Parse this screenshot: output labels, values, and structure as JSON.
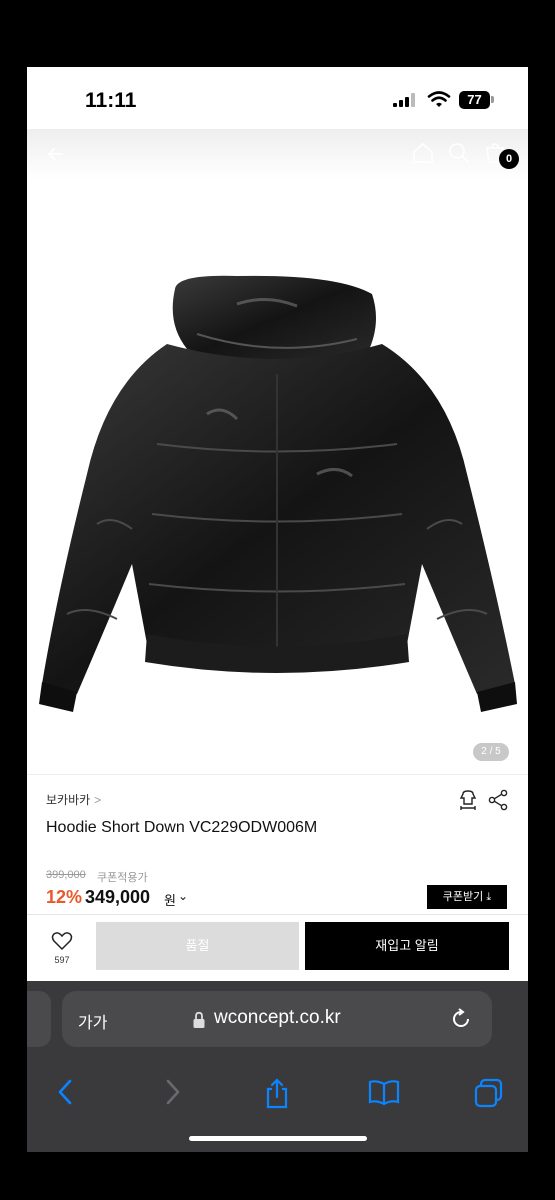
{
  "status": {
    "time": "11:11",
    "battery": "77"
  },
  "header": {
    "cart_count": "0"
  },
  "gallery": {
    "pager": "2 / 5"
  },
  "product": {
    "brand": "보카바카",
    "brand_chevron": ">",
    "name": "Hoodie Short Down VC229ODW006M",
    "original_price": "399,000",
    "coupon_note": "쿠폰적용가",
    "discount": "12%",
    "price": "349,000",
    "currency": "원",
    "currency_chevron": "⌄",
    "coupon_button": "쿠폰받기 ⤓"
  },
  "actions": {
    "like_count": "597",
    "sold_out": "품절",
    "restock_alert": "재입고 알림"
  },
  "browser": {
    "text_size": "가가",
    "url": "wconcept.co.kr"
  },
  "colors": {
    "accent_discount": "#e85a2a",
    "safari_bar": "#3a3a3c",
    "link_blue": "#0a84ff"
  }
}
